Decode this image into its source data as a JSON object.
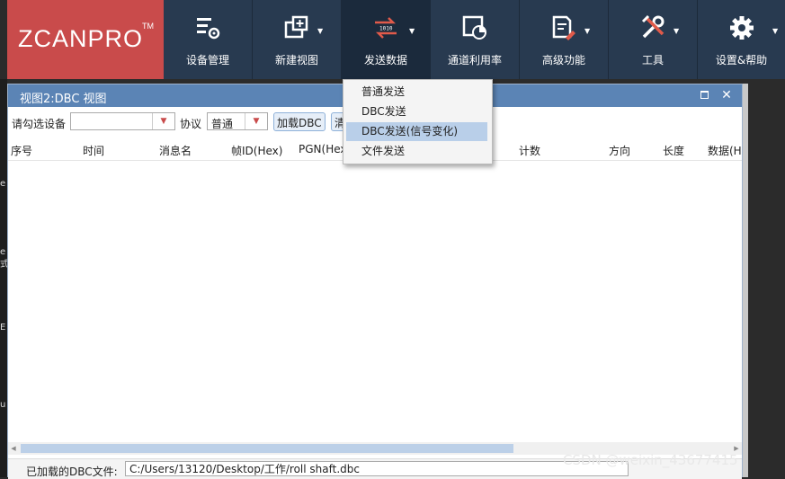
{
  "app": {
    "logo_text": "ZCANPRO",
    "logo_tm": "TM",
    "toolbar": [
      {
        "label": "设备管理",
        "icon": "device-settings-icon",
        "dropdown": false
      },
      {
        "label": "新建视图",
        "icon": "new-view-icon",
        "dropdown": true
      },
      {
        "label": "发送数据",
        "icon": "send-data-icon",
        "dropdown": true
      },
      {
        "label": "通道利用率",
        "icon": "channel-usage-icon",
        "dropdown": false
      },
      {
        "label": "高级功能",
        "icon": "advanced-icon",
        "dropdown": true
      },
      {
        "label": "工具",
        "icon": "tools-icon",
        "dropdown": true
      },
      {
        "label": "设置&帮助",
        "icon": "settings-icon",
        "dropdown": true
      }
    ]
  },
  "send_menu": {
    "items": [
      "普通发送",
      "DBC发送",
      "DBC发送(信号变化)",
      "文件发送"
    ],
    "highlighted_index": 2
  },
  "panel": {
    "title": "视图2:DBC 视图",
    "device_label": "请勾选设备",
    "device_value": "",
    "protocol_label": "协议",
    "protocol_value": "普通",
    "load_dbc_label": "加载DBC",
    "next_button_partial": "清",
    "columns": [
      "序号",
      "时间",
      "消息名",
      "帧ID(Hex)",
      "PGN(Hex",
      "计数",
      "方向",
      "长度",
      "数据(H"
    ],
    "status_label": "已加载的DBC文件:",
    "status_path": "C:/Users/13120/Desktop/工作/roll shaft.dbc"
  },
  "left_strip_chars": [
    "e",
    "e",
    "式",
    "E",
    "u"
  ],
  "watermark": "CSDN @weixin_43677415",
  "colors": {
    "logo_bg": "#c94b4b",
    "toolbar_bg": "#283a50",
    "panel_title_bg": "#5b84b5",
    "menu_highlight": "#b9cfe9"
  }
}
